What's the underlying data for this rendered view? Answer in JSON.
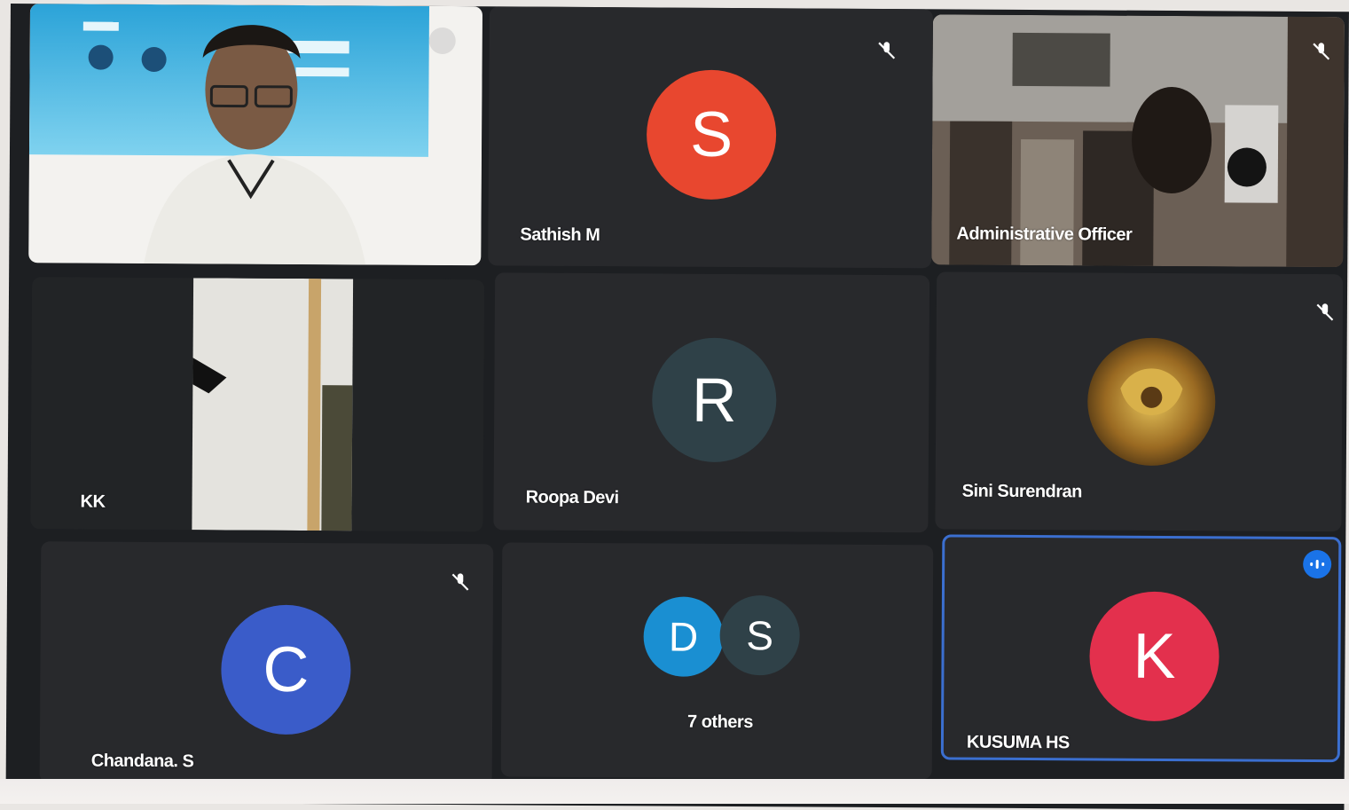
{
  "meeting": {
    "participants": [
      {
        "name": "",
        "type": "video"
      },
      {
        "name": "Sathish M",
        "initial": "S",
        "avatar_color": "#e8472f",
        "muted": true
      },
      {
        "name": "Administrative Officer",
        "type": "video",
        "muted": true
      },
      {
        "name": "KK",
        "type": "video"
      },
      {
        "name": "Roopa Devi",
        "initial": "R",
        "avatar_color": "#2f4148"
      },
      {
        "name": "Sini Surendran",
        "type": "photo-avatar",
        "muted": true
      },
      {
        "name": "Chandana. S",
        "initial": "C",
        "avatar_color": "#3a5cc9",
        "muted": true
      },
      {
        "name": "7 others",
        "initials": [
          "D",
          "S"
        ],
        "avatar_colors": [
          "#1a8fd2",
          "#2f4148"
        ]
      },
      {
        "name": "KUSUMA HS",
        "initial": "K",
        "avatar_color": "#e3304d",
        "speaking": true
      }
    ],
    "active_speaker_border": "#3b6fd0"
  },
  "icons": {
    "mute": "mic-off-icon",
    "speaking": "audio-level-icon",
    "pin": "pin-icon"
  }
}
